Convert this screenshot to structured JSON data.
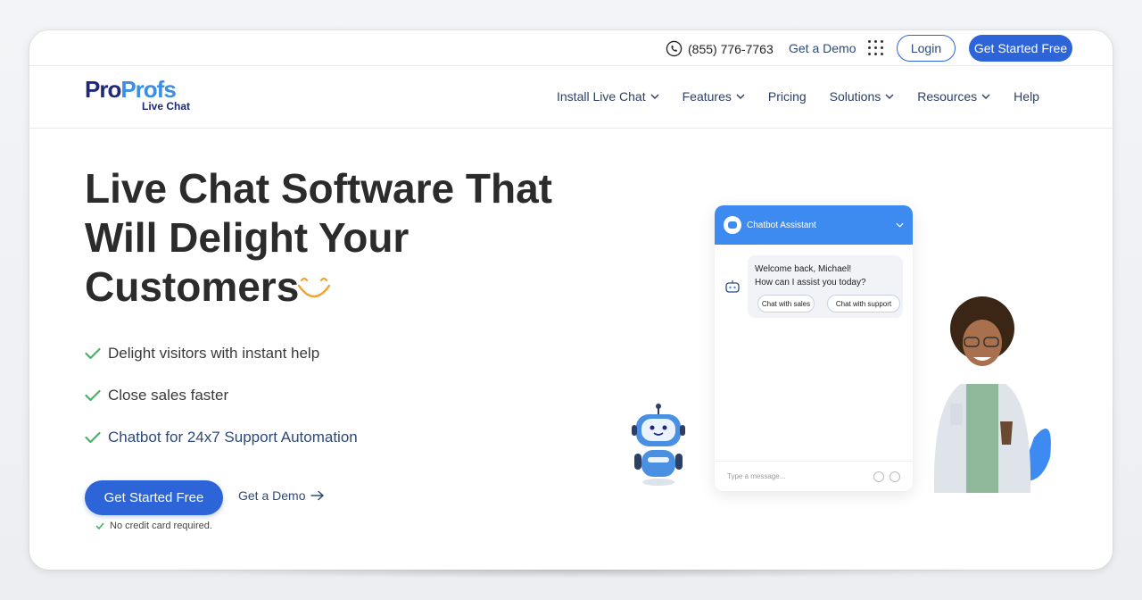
{
  "topbar": {
    "phone": "(855) 776-7763",
    "demo_label": "Get a Demo",
    "login_label": "Login",
    "cta_label": "Get Started Free"
  },
  "logo": {
    "main_a": "Pro",
    "main_b": "Profs",
    "sub": "Live Chat"
  },
  "nav": {
    "items": [
      {
        "label": "Install Live Chat",
        "dropdown": true
      },
      {
        "label": "Features",
        "dropdown": true
      },
      {
        "label": "Pricing",
        "dropdown": false
      },
      {
        "label": "Solutions",
        "dropdown": true
      },
      {
        "label": "Resources",
        "dropdown": true
      },
      {
        "label": "Help",
        "dropdown": false
      }
    ]
  },
  "hero": {
    "title_lines": [
      "Live Chat Software That",
      "Will Delight Your",
      "Customers"
    ],
    "features": [
      "Delight visitors with instant help",
      "Close sales faster",
      "Chatbot for 24x7 Support Automation"
    ],
    "cta_label": "Get Started Free",
    "demo_label": "Get a Demo",
    "note": "No credit card required."
  },
  "chat": {
    "header": "Chatbot Assistant",
    "greeting_line1": "Welcome back, Michael!",
    "greeting_line2": "How can I assist you today?",
    "reply1": "Chat with sales",
    "reply2": "Chat with support",
    "input_placeholder": "Type a message..."
  },
  "colors": {
    "primary": "#2d64d8",
    "chat_header": "#3d8bf0",
    "check": "#4caf6a",
    "smile": "#f0a434"
  }
}
